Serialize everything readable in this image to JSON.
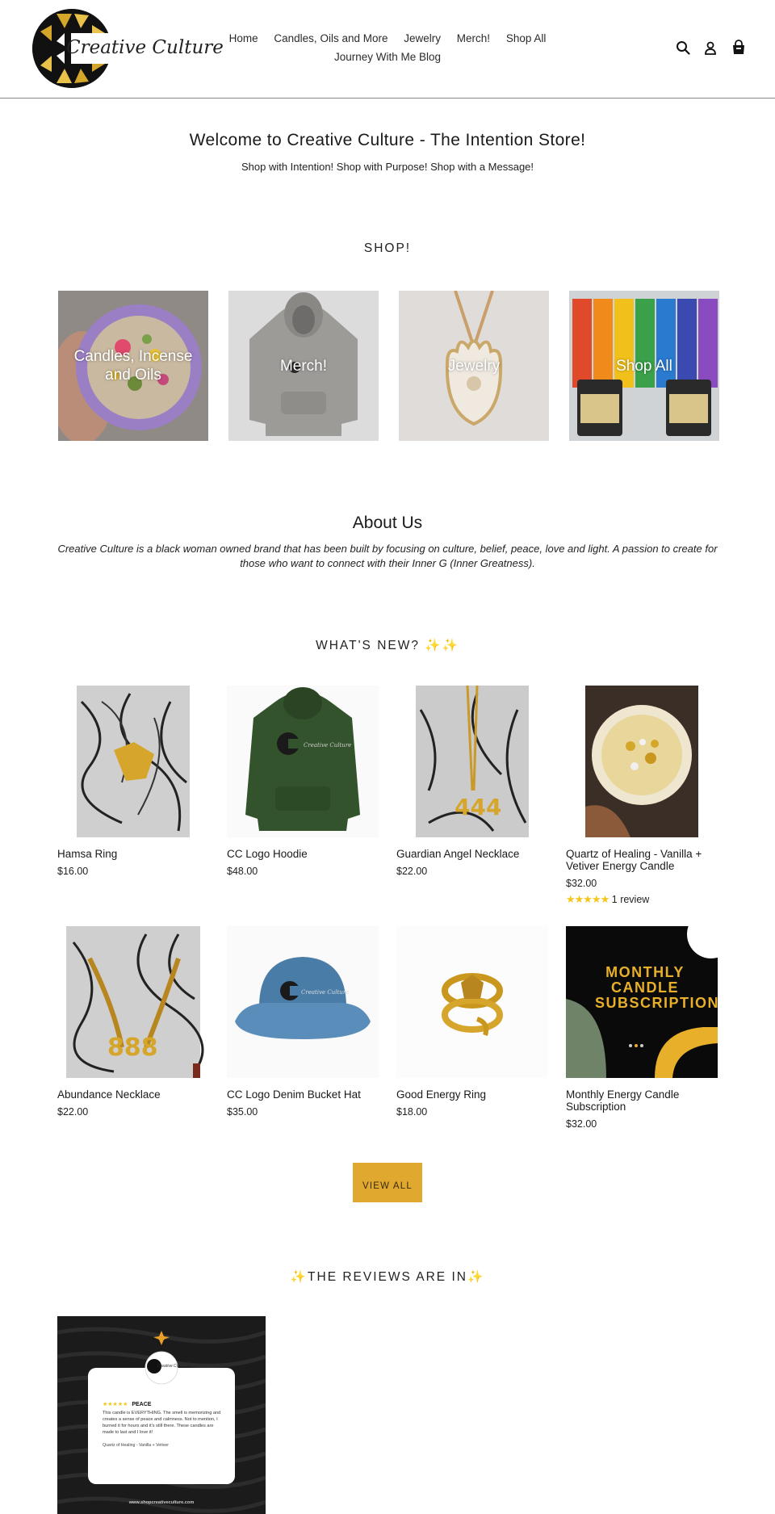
{
  "header": {
    "brand": "Creative Culture",
    "nav": [
      {
        "label": "Home"
      },
      {
        "label": "Candles, Oils and More"
      },
      {
        "label": "Jewelry"
      },
      {
        "label": "Merch!"
      },
      {
        "label": "Shop All"
      },
      {
        "label": "Journey With Me Blog"
      }
    ],
    "icons": [
      "search-icon",
      "account-icon",
      "cart-icon"
    ]
  },
  "welcome": {
    "title": "Welcome to Creative Culture - The Intention Store!",
    "subtitle": "Shop with Intention! Shop with Purpose! Shop with a Message!"
  },
  "shop": {
    "heading": "SHOP!",
    "collections": [
      {
        "label": "Candles, Incense and Oils"
      },
      {
        "label": "Merch!"
      },
      {
        "label": "Jewelry"
      },
      {
        "label": "Shop All"
      }
    ]
  },
  "about": {
    "title": "About Us",
    "text": "Creative Culture is a black woman owned brand that has been built by focusing on culture, belief, peace, love and light. A passion to create for those who want to connect with their Inner G (Inner Greatness)."
  },
  "whats_new": {
    "heading": "WHAT'S NEW? ✨✨",
    "products": [
      {
        "title": "Hamsa Ring",
        "price": "$16.00"
      },
      {
        "title": "CC Logo Hoodie",
        "price": "$48.00"
      },
      {
        "title": "Guardian Angel Necklace",
        "price": "$22.00"
      },
      {
        "title": "Quartz of Healing - Vanilla + Vetiver Energy Candle",
        "price": "$32.00",
        "stars": "★★★★★",
        "rating": 5,
        "reviews": "1 review"
      },
      {
        "title": "Abundance Necklace",
        "price": "$22.00"
      },
      {
        "title": "CC Logo Denim Bucket Hat",
        "price": "$35.00"
      },
      {
        "title": "Good Energy Ring",
        "price": "$18.00"
      },
      {
        "title": "Monthly Energy Candle Subscription",
        "price": "$32.00",
        "image_text": "MONTHLY CANDLE SUBSCRIPTION"
      }
    ],
    "view_all": "VIEW ALL"
  },
  "reviews": {
    "heading": "✨THE REVIEWS ARE IN✨",
    "card": {
      "brand": "Creative Culture",
      "stars": "★★★★★",
      "title": "PEACE",
      "body": "This candle is EVERYTHING. The smell is memorizing and creates a sense of peace and calmness. Not to mention, I burned it for hours and it's still there. These candles are made to last and I love it!",
      "product": "Quartz of Healing - Vanilla + Vetiver",
      "url": "www.shopcreativeculture.com"
    }
  },
  "colors": {
    "accent": "#e0a82e",
    "gold": "#d4a62a",
    "star": "#f5c518",
    "divider": "#8a8a8a"
  }
}
